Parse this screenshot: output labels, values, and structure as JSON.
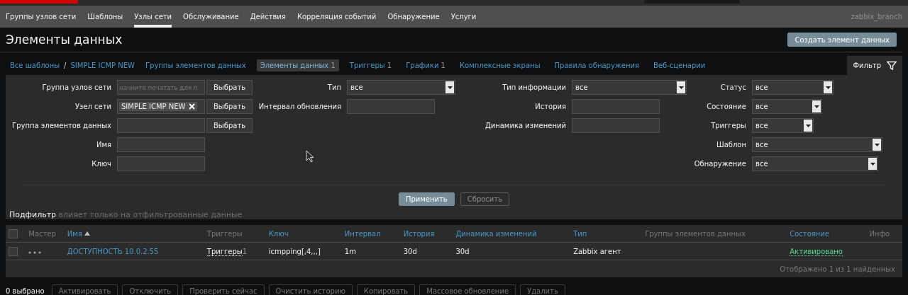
{
  "subnav": {
    "items": [
      {
        "label": "Группы узлов сети",
        "selected": false
      },
      {
        "label": "Шаблоны",
        "selected": false
      },
      {
        "label": "Узлы сети",
        "selected": true
      },
      {
        "label": "Обслуживание",
        "selected": false
      },
      {
        "label": "Действия",
        "selected": false
      },
      {
        "label": "Корреляция событий",
        "selected": false
      },
      {
        "label": "Обнаружение",
        "selected": false
      },
      {
        "label": "Услуги",
        "selected": false
      }
    ],
    "server_name": "zabbix_branch"
  },
  "page_title": "Элементы данных",
  "create_button": "Создать элемент данных",
  "breadcrumbs": [
    "Все шаблоны",
    "SIMPLE ICMP NEW"
  ],
  "breadcrumb_separator": "/",
  "tabs": [
    {
      "label": "Группы элементов данных",
      "selected": false
    },
    {
      "label": "Элементы данных",
      "count": "1",
      "selected": true
    },
    {
      "label": "Триггеры",
      "count": "1",
      "selected": false
    },
    {
      "label": "Графики",
      "count": "1",
      "selected": false
    },
    {
      "label": "Комплексные экраны",
      "selected": false
    },
    {
      "label": "Правила обнаружения",
      "selected": false
    },
    {
      "label": "Веб-сценарии",
      "selected": false
    }
  ],
  "filter_tab": "Фильтр",
  "filter": {
    "columns": [
      [
        {
          "label": "Группа узлов сети",
          "kind": "multiselect",
          "placeholder": "начните печатать для п",
          "button": "Выбрать"
        },
        {
          "label": "Узел сети",
          "kind": "multiselect",
          "tag": "SIMPLE ICMP NEW",
          "button": "Выбрать"
        },
        {
          "label": "Группа элементов данных",
          "kind": "multiselect",
          "button": "Выбрать"
        },
        {
          "label": "Имя",
          "kind": "text"
        },
        {
          "label": "Ключ",
          "kind": "text"
        }
      ],
      [
        {
          "label": "Тип",
          "kind": "select",
          "value": "все"
        },
        {
          "label": "Интервал обновления",
          "kind": "text"
        }
      ],
      [
        {
          "label": "Тип информации",
          "kind": "select",
          "value": "все"
        },
        {
          "label": "История",
          "kind": "text"
        },
        {
          "label": "Динамика изменений",
          "kind": "text"
        }
      ],
      [
        {
          "label": "Статус",
          "kind": "select",
          "value": "все"
        },
        {
          "label": "Состояние",
          "kind": "select",
          "value": "все"
        },
        {
          "label": "Триггеры",
          "kind": "select",
          "value": "все"
        },
        {
          "label": "Шаблон",
          "kind": "select",
          "value": "все"
        },
        {
          "label": "Обнаружение",
          "kind": "select",
          "value": "все"
        }
      ]
    ],
    "apply": "Применить",
    "reset": "Сбросить"
  },
  "subfilter": {
    "title": "Подфильтр",
    "note": "влияет только на отфильтрованные данные"
  },
  "table": {
    "select_all_checked": false,
    "columns": [
      {
        "label": "Мастер",
        "sortable": false
      },
      {
        "label": "Имя",
        "sortable": true,
        "sorted": true
      },
      {
        "label": "Триггеры",
        "sortable": false
      },
      {
        "label": "Ключ",
        "sortable": true
      },
      {
        "label": "Интервал",
        "sortable": true
      },
      {
        "label": "История",
        "sortable": true
      },
      {
        "label": "Динамика изменений",
        "sortable": true
      },
      {
        "label": "Тип",
        "sortable": true
      },
      {
        "label": "Группы элементов данных",
        "sortable": false
      },
      {
        "label": "Состояние",
        "sortable": true
      },
      {
        "label": "Инфо",
        "sortable": false
      }
    ],
    "rows": [
      {
        "checked": false,
        "name": "ДОСТУПНОСТЬ 10.0.2.55",
        "triggers": "Триггеры",
        "trigger_count": "1",
        "key": "icmpping[,4,,,]",
        "interval": "1m",
        "history": "30d",
        "trends": "30d",
        "type": "Zabbix агент",
        "status": "Активировано",
        "enabled": true
      }
    ],
    "summary": "Отображено 1 из 1 найденных"
  },
  "footer": {
    "selected": "0 выбрано",
    "buttons": [
      "Активировать",
      "Отключить",
      "Проверить сейчас",
      "Очистить историю",
      "Копировать",
      "Массовое обновление",
      "Удалить"
    ]
  }
}
